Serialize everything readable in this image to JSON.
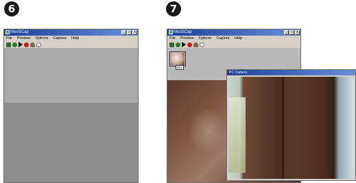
{
  "steps": {
    "left": "6",
    "right": "7"
  },
  "window": {
    "title": "MooSCap",
    "menu": [
      "File",
      "Preview",
      "Options",
      "Capture",
      "Help"
    ],
    "buttons": {
      "minimize": "_",
      "maximize": "□",
      "close": "x"
    }
  },
  "toolbar_icons": [
    "save-icon",
    "check-icon",
    "play-icon",
    "record-icon",
    "person-icon",
    "timer-icon"
  ],
  "thumbnail": {
    "label": "001"
  },
  "preview_window": {
    "title": "PC Camera"
  },
  "colors": {
    "title_bar": "#1c3f9a",
    "record": "#d01a1a",
    "window_face": "#d4d0c8"
  }
}
